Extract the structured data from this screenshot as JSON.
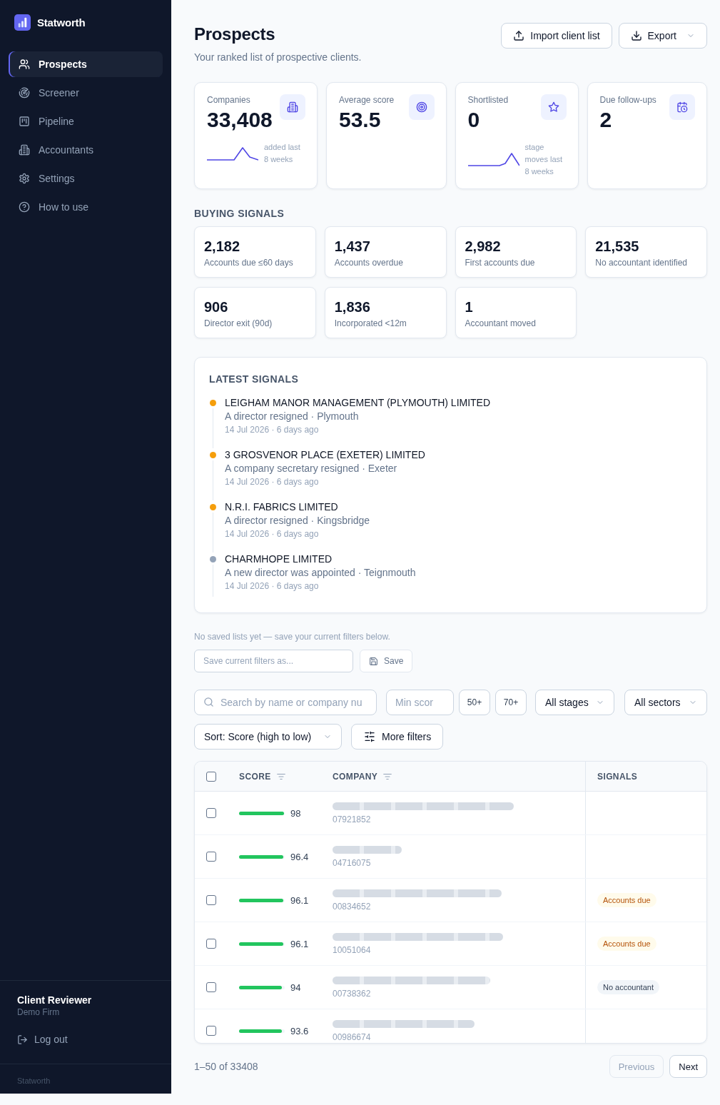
{
  "sidebar": {
    "brand": "Statworth",
    "nav": [
      {
        "label": "Prospects",
        "selected": true
      },
      {
        "label": "Screener",
        "selected": false
      },
      {
        "label": "Pipeline",
        "selected": false
      },
      {
        "label": "Accountants",
        "selected": false
      },
      {
        "label": "Settings",
        "selected": false
      },
      {
        "label": "How to use",
        "selected": false
      }
    ],
    "user": {
      "name": "Client Reviewer",
      "org": "Demo Firm"
    },
    "logout": "Log out",
    "footer": "Statworth"
  },
  "header": {
    "title": "Prospects",
    "subtitle": "Your ranked list of prospective clients.",
    "actions": [
      {
        "label": "Import client list",
        "kind": "upload",
        "menu": false
      },
      {
        "label": "Export",
        "kind": "download",
        "menu": true
      }
    ]
  },
  "stats": [
    {
      "label": "Companies",
      "value": "33,408",
      "trend": "added last 8 weeks"
    },
    {
      "label": "Average score",
      "value": "53.5"
    },
    {
      "label": "Shortlisted",
      "value": "0",
      "trend": "stage moves last 8 weeks"
    },
    {
      "label": "Due follow-ups",
      "value": "2"
    }
  ],
  "buying_signals": {
    "title": "BUYING SIGNALS",
    "cards": [
      {
        "value": "2,182",
        "label": "Accounts due ≤60 days"
      },
      {
        "value": "1,437",
        "label": "Accounts overdue"
      },
      {
        "value": "2,982",
        "label": "First accounts due"
      },
      {
        "value": "21,535",
        "label": "No accountant identified"
      },
      {
        "value": "906",
        "label": "Director exit (90d)"
      },
      {
        "value": "1,836",
        "label": "Incorporated <12m"
      },
      {
        "value": "1",
        "label": "Accountant moved"
      }
    ]
  },
  "latest_signals": {
    "title": "LATEST SIGNALS",
    "items": [
      {
        "company": "LEIGHAM MANOR MANAGEMENT (PLYMOUTH) LIMITED",
        "detail": "A director resigned · Plymouth",
        "time": "14 Jul 2026 · 6 days ago",
        "color": "#f59e0b"
      },
      {
        "company": "3 GROSVENOR PLACE (EXETER) LIMITED",
        "detail": "A company secretary resigned · Exeter",
        "time": "14 Jul 2026 · 6 days ago",
        "color": "#f59e0b"
      },
      {
        "company": "N.R.I. FABRICS LIMITED",
        "detail": "A director resigned · Kingsbridge",
        "time": "14 Jul 2026 · 6 days ago",
        "color": "#f59e0b"
      },
      {
        "company": "CHARMHOPE LIMITED",
        "detail": "A new director was appointed · Teignmouth",
        "time": "14 Jul 2026 · 6 days ago",
        "color": "#94a3b8"
      }
    ]
  },
  "saved_lists": {
    "message": "No saved lists yet — save your current filters below.",
    "name_field": {
      "placeholder": "Save current filters as..."
    },
    "save_button": "Save"
  },
  "filters": {
    "search": {
      "placeholder": "Search by name or company nu"
    },
    "min_score": {
      "placeholder": "Min scor"
    },
    "quick_scores": [
      "50+",
      "70+"
    ],
    "stage": "All stages",
    "sector": "All sectors",
    "sort": "Sort: Score (high to low)",
    "more_filters": "More filters"
  },
  "table": {
    "select_all": {
      "checked": false
    },
    "columns": [
      {
        "label": "SCORE",
        "filter": true
      },
      {
        "label": "COMPANY",
        "filter": true
      },
      {
        "label": "SIGNALS",
        "filter": false
      }
    ],
    "rows": [
      {
        "checked": false,
        "score": "98",
        "level": 0.98,
        "number": "07921852"
      },
      {
        "checked": false,
        "score": "96.4",
        "level": 0.964,
        "number": "04716075"
      },
      {
        "checked": false,
        "score": "96.1",
        "level": 0.961,
        "number": "00834652",
        "signals": [
          {
            "label": "Accounts due",
            "kind": "warning"
          }
        ]
      },
      {
        "checked": false,
        "score": "96.1",
        "level": 0.961,
        "number": "10051064",
        "signals": [
          {
            "label": "Accounts due",
            "kind": "warning"
          }
        ]
      },
      {
        "checked": false,
        "score": "94",
        "level": 0.94,
        "number": "00738362",
        "signals": [
          {
            "label": "No accountant",
            "kind": "neutral"
          }
        ]
      },
      {
        "checked": false,
        "score": "93.6",
        "level": 0.936,
        "number": "00986674"
      }
    ]
  },
  "pagination": {
    "summary": "1–50 of 33408",
    "previous": {
      "label": "Previous",
      "disabled": true
    },
    "next": {
      "label": "Next",
      "disabled": false
    }
  }
}
